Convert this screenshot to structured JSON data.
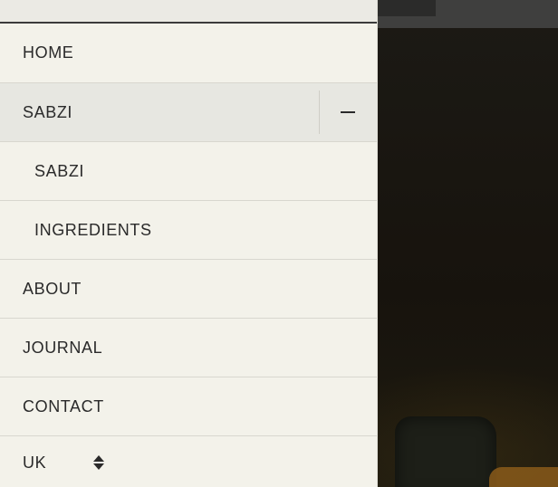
{
  "nav": {
    "items": [
      {
        "label": "HOME"
      },
      {
        "label": "SABZI"
      },
      {
        "label": "SABZI"
      },
      {
        "label": "INGREDIENTS"
      },
      {
        "label": "ABOUT"
      },
      {
        "label": "JOURNAL"
      },
      {
        "label": "CONTACT"
      }
    ],
    "expanded_item": "SABZI",
    "toggle_icon": "minus-icon"
  },
  "locale": {
    "selected": "UK",
    "icon": "updown-chevron-icon"
  },
  "colors": {
    "drawer_background": "#f3f2ea",
    "active_row": "#e7e7e1",
    "text": "#2a2a2a",
    "divider": "#d8d7cf"
  }
}
